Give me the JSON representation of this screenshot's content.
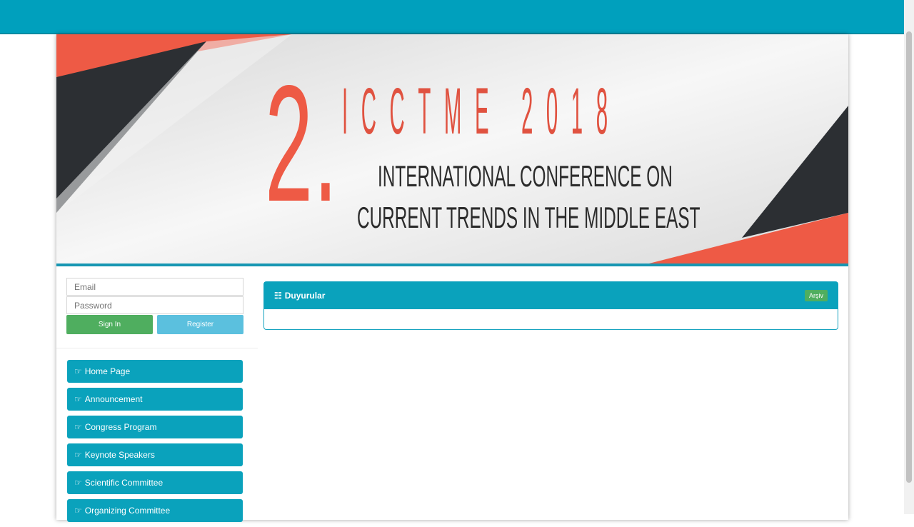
{
  "banner": {
    "number": "2.",
    "title": "ICCTME 2018",
    "subtitle_line1": "INTERNATIONAL CONFERENCE ON",
    "subtitle_line2": "CURRENT TRENDS IN THE MIDDLE EAST"
  },
  "login": {
    "email_placeholder": "Email",
    "password_placeholder": "Password",
    "signin_label": "Sign In",
    "register_label": "Register"
  },
  "menu": {
    "items": [
      {
        "label": "Home Page",
        "icon": "hand-right-icon"
      },
      {
        "label": "Announcement",
        "icon": "hand-right-icon"
      },
      {
        "label": "Congress Program",
        "icon": "hand-right-icon"
      },
      {
        "label": "Keynote Speakers",
        "icon": "hand-right-icon"
      },
      {
        "label": "Scientific Committee",
        "icon": "hand-right-icon"
      },
      {
        "label": "Organizing Committee",
        "icon": "hand-right-icon"
      }
    ]
  },
  "announcements": {
    "title": "Duyurular",
    "icon": "list-icon",
    "badge": "Arşiv"
  },
  "colors": {
    "topbar": "#00a0bd",
    "menu": "#0aa2bc",
    "signin": "#4fae5f",
    "register": "#5bc0de",
    "accent_red": "#ee5a45"
  }
}
